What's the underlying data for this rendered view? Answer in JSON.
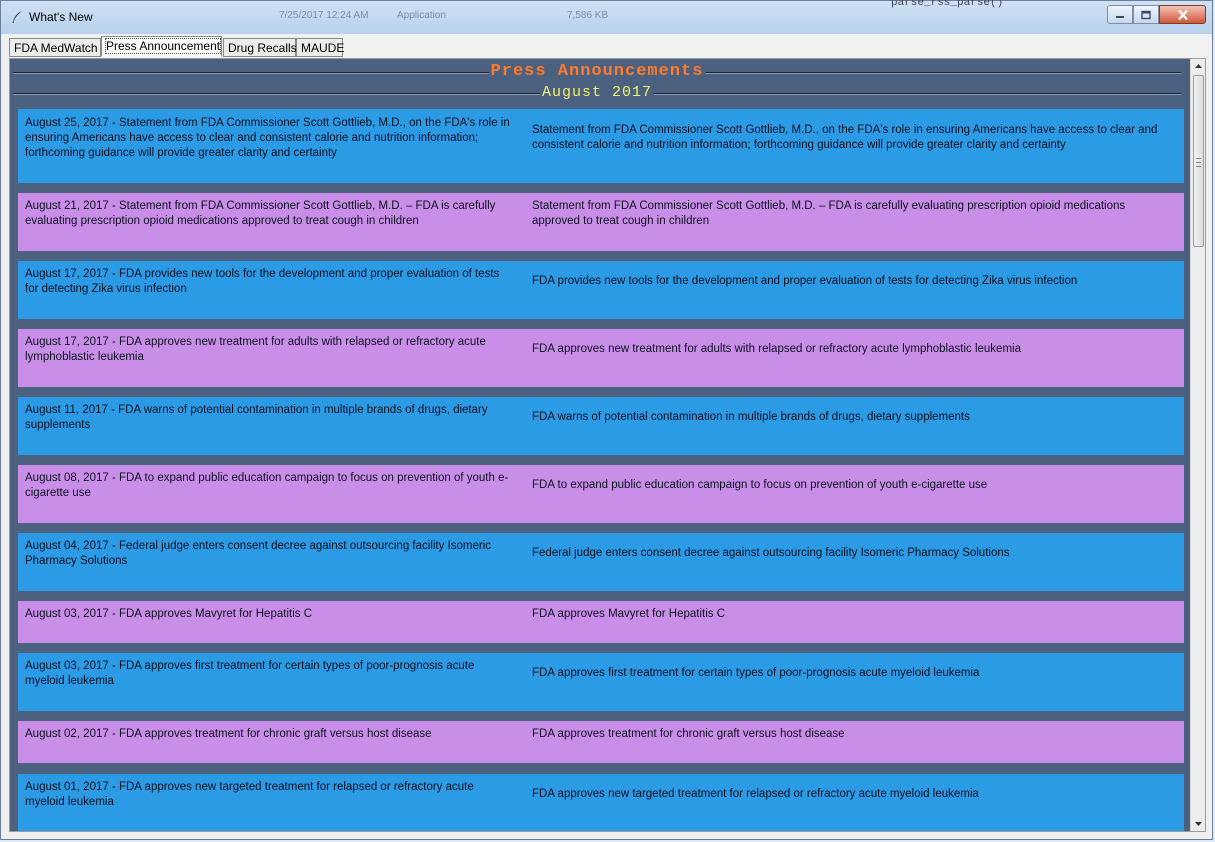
{
  "window": {
    "title": "What's New",
    "ghost_text": [
      "7/25/2017 12:24 AM",
      "Application",
      "7,586 KB"
    ],
    "ghost_code": "parse_rss_parse()"
  },
  "tabs": [
    {
      "label": "FDA MedWatch",
      "active": false
    },
    {
      "label": "Press Announcement",
      "active": true
    },
    {
      "label": "Drug Recalls",
      "active": false
    },
    {
      "label": "MAUDE",
      "active": false
    }
  ],
  "content": {
    "heading": "Press Announcements",
    "subheading": "August 2017",
    "colors": {
      "row_blue": "#2c9be6",
      "row_purple": "#c98fe8",
      "heading": "#ff7a2a",
      "subheading": "#f2f26a",
      "background": "#4c6180"
    },
    "items": [
      {
        "left": "August 25, 2017 - Statement from FDA Commissioner Scott Gottlieb, M.D., on the FDA's role in ensuring Americans have access to clear and consistent calorie and nutrition information; forthcoming guidance will provide greater clarity and certainty",
        "right": "Statement from FDA Commissioner Scott Gottlieb, M.D., on the FDA's role in ensuring Americans have access to clear and consistent calorie and nutrition information; forthcoming guidance will provide greater clarity and certainty",
        "color": "blue"
      },
      {
        "left": "August 21, 2017 - Statement from FDA Commissioner Scott Gottlieb, M.D. – FDA is carefully evaluating prescription opioid medications approved to treat cough in children",
        "right": "Statement from FDA Commissioner Scott Gottlieb, M.D. – FDA is carefully evaluating prescription opioid medications approved to treat cough in children",
        "color": "purple"
      },
      {
        "left": "August 17, 2017 - FDA provides new tools for the development and proper evaluation of tests for detecting Zika virus infection",
        "right": "FDA provides new tools for the development and proper evaluation of tests for detecting Zika virus infection",
        "color": "blue"
      },
      {
        "left": "August 17, 2017 - FDA approves new treatment for adults with relapsed or refractory acute lymphoblastic leukemia",
        "right": "FDA approves new treatment for adults with relapsed or refractory acute lymphoblastic leukemia",
        "color": "purple"
      },
      {
        "left": "August 11, 2017 - FDA warns of potential contamination in multiple brands of drugs, dietary supplements",
        "right": "FDA warns of potential contamination in multiple brands of drugs, dietary supplements",
        "color": "blue"
      },
      {
        "left": "August 08, 2017 - FDA to expand public education campaign to focus on prevention of youth e-cigarette use",
        "right": "FDA to expand public education campaign to focus on prevention of youth e-cigarette use",
        "color": "purple"
      },
      {
        "left": "August 04, 2017 - Federal judge enters consent decree against outsourcing facility Isomeric Pharmacy Solutions",
        "right": "Federal judge enters consent decree against outsourcing facility Isomeric Pharmacy Solutions",
        "color": "blue"
      },
      {
        "left": "August 03, 2017 - FDA approves Mavyret for Hepatitis C",
        "right": "FDA approves Mavyret for Hepatitis C",
        "color": "purple"
      },
      {
        "left": "August 03, 2017 - FDA approves first treatment for certain types of poor-prognosis acute myeloid leukemia",
        "right": "FDA approves first treatment for certain types of poor-prognosis acute myeloid leukemia",
        "color": "blue"
      },
      {
        "left": "August 02, 2017 - FDA approves treatment for chronic graft versus host disease",
        "right": "FDA approves treatment for chronic graft versus host disease",
        "color": "purple"
      },
      {
        "left": "August 01, 2017 - FDA approves new targeted treatment for relapsed or refractory acute myeloid leukemia",
        "right": "FDA approves new targeted treatment for relapsed or refractory acute myeloid leukemia",
        "color": "blue"
      }
    ]
  },
  "icons": {
    "app": "quill-icon",
    "minimize": "minimize-icon",
    "maximize": "maximize-icon",
    "close": "close-icon",
    "scroll_up": "arrow-up-icon",
    "scroll_down": "arrow-down-icon"
  }
}
